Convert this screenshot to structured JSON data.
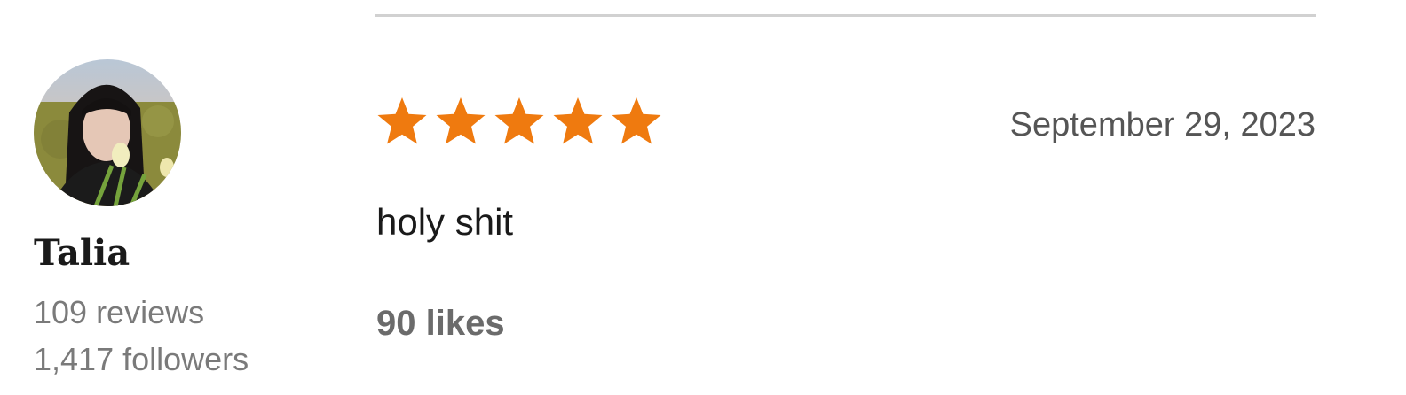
{
  "reviewer": {
    "name": "Talia",
    "reviews": "109 reviews",
    "followers": "1,417 followers"
  },
  "review": {
    "rating": 5,
    "rating_max": 5,
    "date": "September 29, 2023",
    "text": "holy shit",
    "likes": "90 likes"
  },
  "colors": {
    "star": "#ef7a0f",
    "divider": "#d1d1d1"
  },
  "icons": {
    "avatar": "profile-photo",
    "star": "star-icon"
  }
}
